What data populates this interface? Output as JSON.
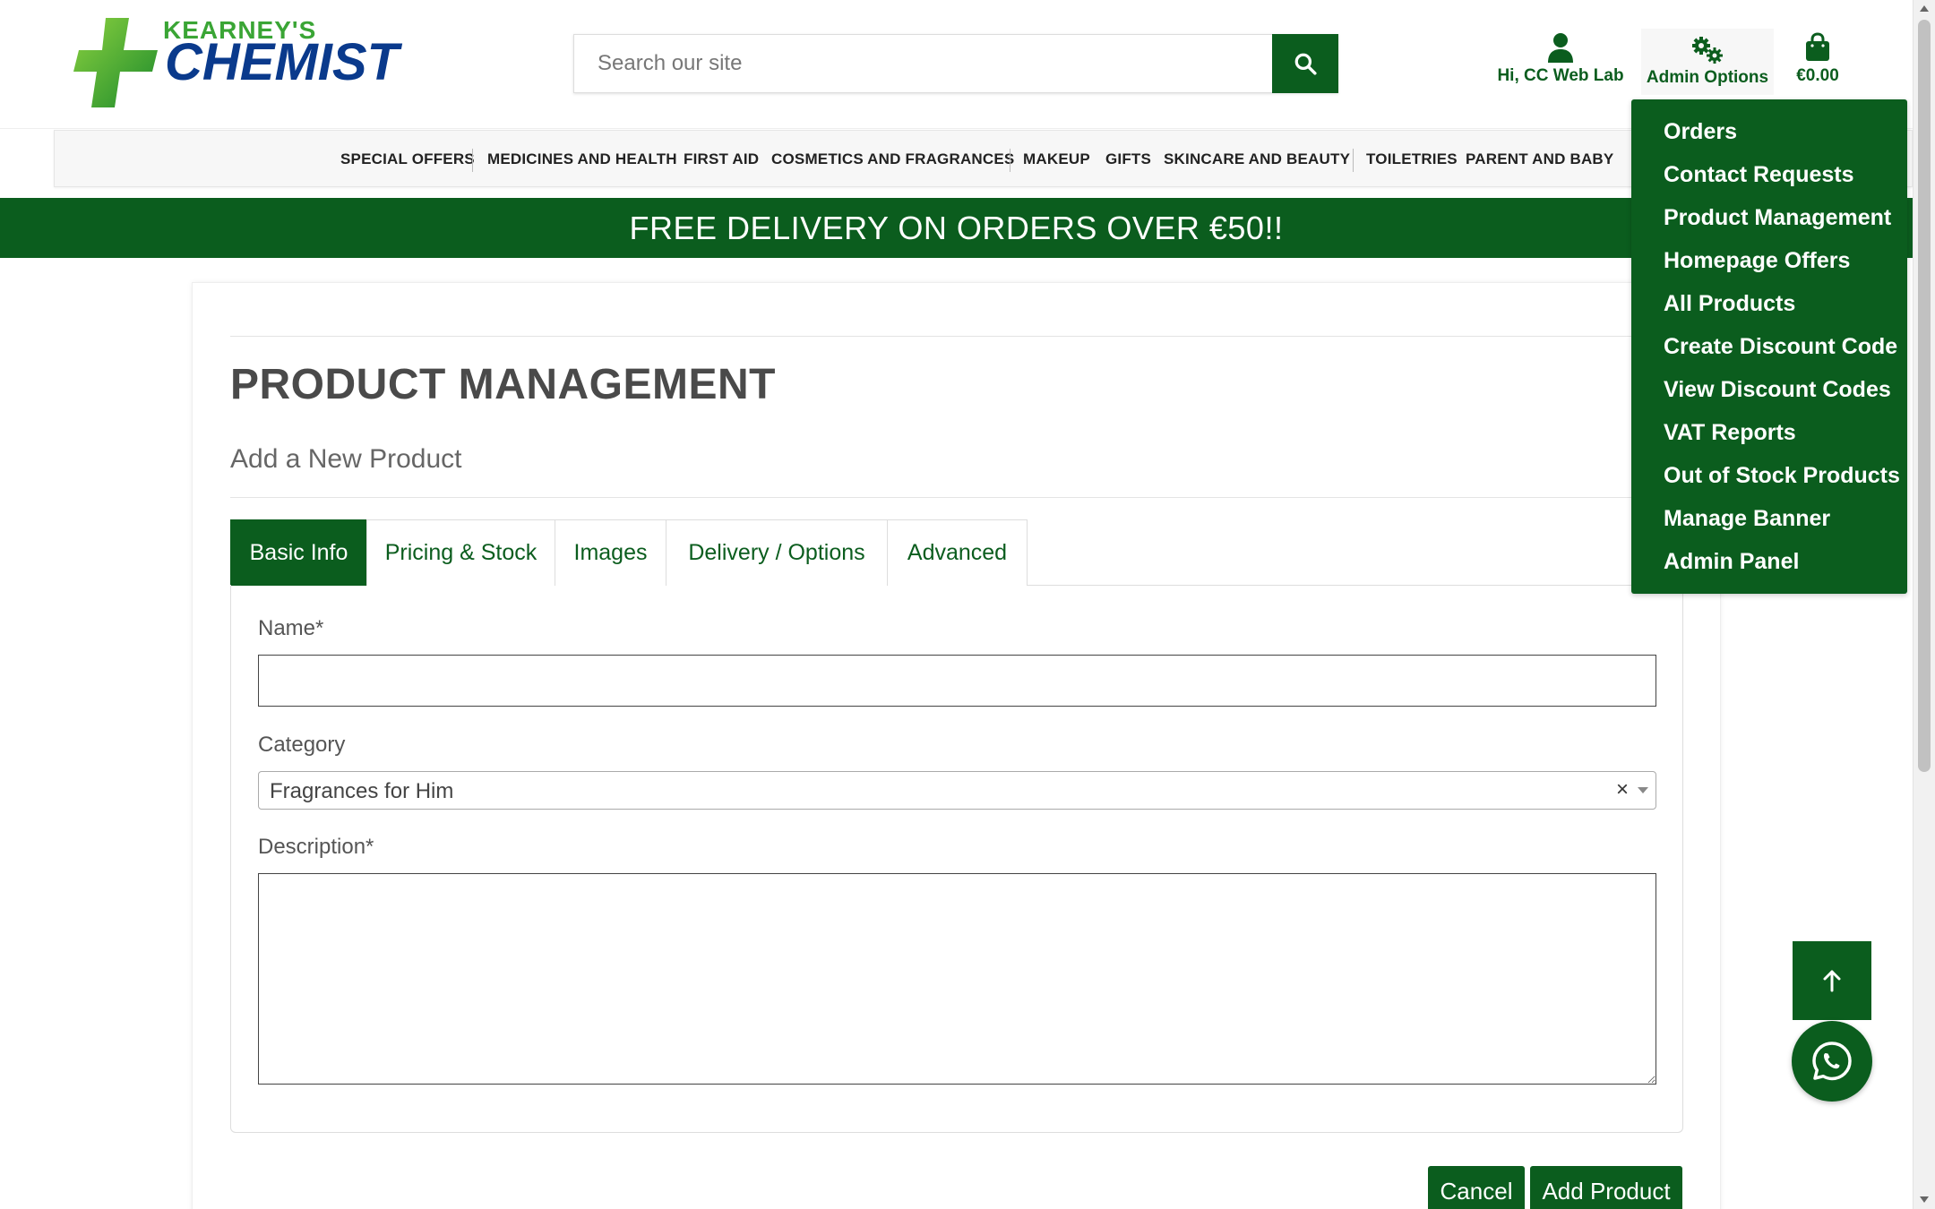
{
  "brand": {
    "name_small": "KEARNEY'S",
    "name_big": "CHEMIST",
    "green": "#3aa535",
    "blue": "#0a3a8c"
  },
  "theme": {
    "primary": "#0b5d1e",
    "white": "#ffffff"
  },
  "search": {
    "placeholder": "Search our site",
    "value": ""
  },
  "header": {
    "user_label": "Hi, CC Web Lab",
    "admin_label": "Admin Options",
    "cart_label": "€0.00"
  },
  "categories": [
    "SPECIAL OFFERS",
    "MEDICINES AND HEALTH",
    "FIRST AID",
    "COSMETICS AND FRAGRANCES",
    "MAKEUP",
    "GIFTS",
    "SKINCARE AND BEAUTY",
    "TOILETRIES",
    "PARENT AND BABY"
  ],
  "banner": {
    "text": "FREE DELIVERY ON ORDERS OVER €50!!"
  },
  "page": {
    "title": "PRODUCT MANAGEMENT",
    "subtitle": "Add a New Product"
  },
  "tabs": [
    {
      "label": "Basic Info",
      "active": true
    },
    {
      "label": "Pricing & Stock",
      "active": false
    },
    {
      "label": "Images",
      "active": false
    },
    {
      "label": "Delivery / Options",
      "active": false
    },
    {
      "label": "Advanced",
      "active": false
    }
  ],
  "form": {
    "name_label": "Name*",
    "name_value": "",
    "category_label": "Category",
    "category_value": "Fragrances for Him",
    "category_clear": "×",
    "description_label": "Description*",
    "description_value": ""
  },
  "actions": {
    "cancel": "Cancel",
    "add": "Add Product"
  },
  "admin_menu": [
    "Orders",
    "Contact Requests",
    "Product Management",
    "Homepage Offers",
    "All Products",
    "Create Discount Code",
    "View Discount Codes",
    "VAT Reports",
    "Out of Stock Products",
    "Manage Banner",
    "Admin Panel"
  ],
  "icons": {
    "search": "search-icon",
    "user": "user-icon",
    "admin": "cogs-icon",
    "cart": "shopping-bag-icon",
    "to_top": "arrow-up-icon",
    "whatsapp": "whatsapp-icon"
  }
}
